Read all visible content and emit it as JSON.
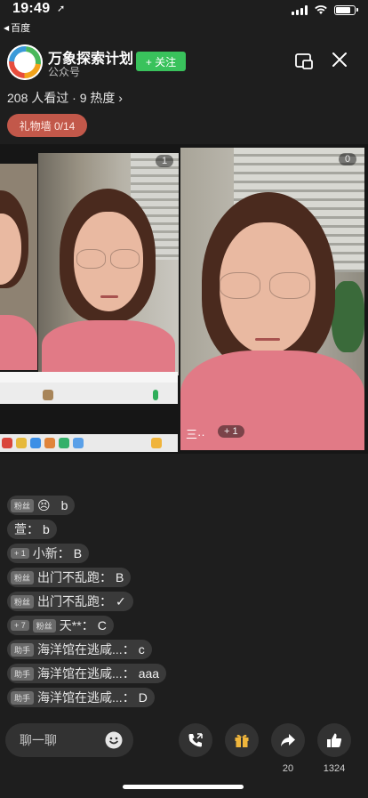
{
  "status_bar": {
    "time": "19:49"
  },
  "back_app": {
    "label": "百度"
  },
  "header": {
    "account_name": "万象探索计划",
    "account_type": "公众号",
    "follow_label": "+ 关注"
  },
  "viewers_text": "208 人看过 · 9 热度 ›",
  "gift_wall_label": "礼物墙 0/14",
  "video": {
    "feed2_count": "1",
    "feed3_count": "0",
    "feed3_label": "三··",
    "feed3_badge": "+ 1"
  },
  "chat": [
    {
      "tag": "粉丝",
      "user": "😣",
      "text": "b"
    },
    {
      "tag": "",
      "user": "萱",
      "text": "b"
    },
    {
      "tag": "+ 1",
      "user": "小新",
      "text": "B"
    },
    {
      "tag": "粉丝",
      "user": "出门不乱跑",
      "text": "B"
    },
    {
      "tag": "粉丝",
      "user": "出门不乱跑",
      "text": "✓"
    },
    {
      "tag": "+ 7",
      "tag2": "粉丝",
      "user": "天**",
      "text": "C"
    },
    {
      "tag": "助手",
      "user": "海洋馆在逃咸...",
      "text": "c"
    },
    {
      "tag": "助手",
      "user": "海洋馆在逃咸...",
      "text": "aaa"
    },
    {
      "tag": "助手",
      "user": "海洋馆在逃咸...",
      "text": "D"
    }
  ],
  "bottom": {
    "input_placeholder": "聊一聊",
    "share_count": "20",
    "like_count": "1324"
  },
  "colors": {
    "accent_green": "#39c25c",
    "gift_wall": "#c2584a",
    "background": "#1e1e1e"
  }
}
